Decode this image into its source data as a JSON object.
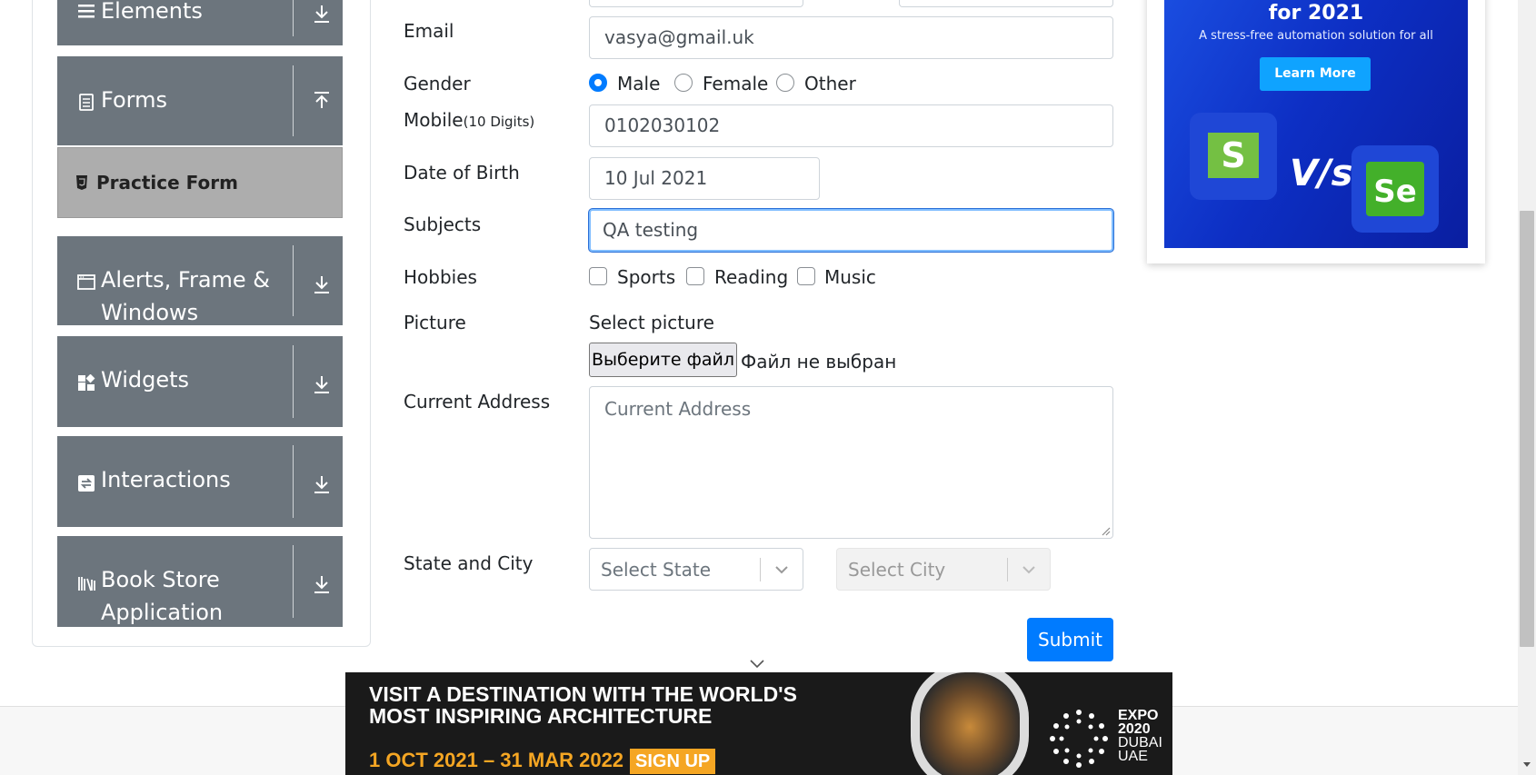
{
  "sidebar": {
    "groups": {
      "elements": {
        "label": "Elements"
      },
      "forms": {
        "label": "Forms"
      },
      "alerts": {
        "label": "Alerts, Frame & Windows"
      },
      "widgets": {
        "label": "Widgets"
      },
      "interactions": {
        "label": "Interactions"
      },
      "bookstore": {
        "label": "Book Store Application"
      }
    },
    "forms_sub": {
      "practice_form": "Practice Form"
    }
  },
  "form": {
    "email_label": "Email",
    "email_value": "vasya@gmail.uk",
    "gender_label": "Gender",
    "gender_options": [
      "Male",
      "Female",
      "Other"
    ],
    "gender_selected": "Male",
    "mobile_label": "Mobile",
    "mobile_hint": "(10 Digits)",
    "mobile_value": "0102030102",
    "dob_label": "Date of Birth",
    "dob_value": "10 Jul 2021",
    "subjects_label": "Subjects",
    "subjects_value": "QA testing",
    "hobbies_label": "Hobbies",
    "hobbies": [
      "Sports",
      "Reading",
      "Music"
    ],
    "picture_label": "Picture",
    "select_picture": "Select picture",
    "file_button": "Выберите файл",
    "file_status": "Файл не выбран",
    "address_label": "Current Address",
    "address_placeholder": "Current Address",
    "state_city_label": "State and City",
    "state_placeholder": "Select State",
    "city_placeholder": "Select City",
    "submit": "Submit"
  },
  "ad_right": {
    "title": "for 2021",
    "subtitle": "A stress-free automation solution for all",
    "button": "Learn More",
    "vs": "V/s",
    "logo_left": "S",
    "logo_right": "Se"
  },
  "banner": {
    "line1": "VISIT A DESTINATION WITH THE WORLD'S",
    "line2": "MOST INSPIRING ARCHITECTURE",
    "dates": "1 OCT 2021 – 31 MAR 2022",
    "cta": "SIGN UP",
    "expo": [
      "EXPO",
      "2020",
      "DUBAI",
      "UAE"
    ]
  },
  "colors": {
    "sidebar_group": "#6c757d",
    "sidebar_active": "#adadad",
    "primary": "#007bff",
    "banner_accent": "#f5a623"
  }
}
